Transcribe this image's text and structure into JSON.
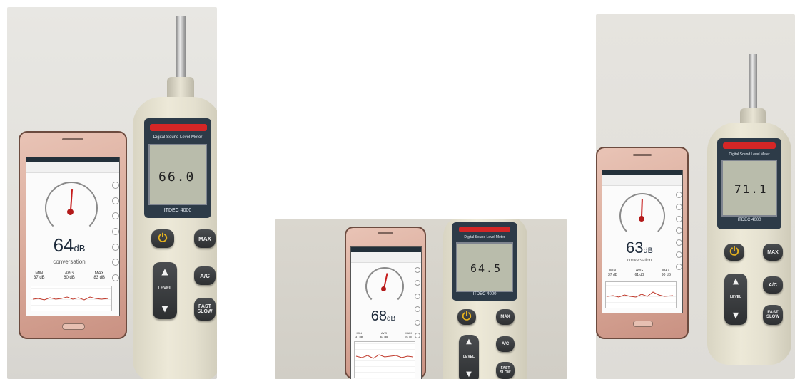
{
  "photos": [
    {
      "phone": {
        "reading": "64",
        "unit": "dB",
        "caption": "conversation",
        "stats_labels": [
          "MIN",
          "AVG",
          "MAX"
        ],
        "stats_values": [
          "37 dB",
          "60 dB",
          "83 dB"
        ]
      },
      "meter": {
        "brand": "Digital Sound Level Meter",
        "display": "66.0",
        "model": "ITDEC 4000"
      }
    },
    {
      "phone": {
        "reading": "68",
        "unit": "dB",
        "caption": "",
        "stats_labels": [
          "MIN",
          "AVG",
          "MAX"
        ],
        "stats_values": [
          "37 dB",
          "63 dB",
          "91 dB"
        ]
      },
      "meter": {
        "brand": "Digital Sound Level Meter",
        "display": "64.5",
        "model": "ITDEC 4000"
      }
    },
    {
      "phone": {
        "reading": "63",
        "unit": "dB",
        "caption": "conversation",
        "stats_labels": [
          "MIN",
          "AVG",
          "MAX"
        ],
        "stats_values": [
          "37 dB",
          "61 dB",
          "90 dB"
        ]
      },
      "meter": {
        "brand": "Digital Sound Level Meter",
        "display": "71.1",
        "model": "ITDEC 4000"
      }
    }
  ],
  "buttons": {
    "power": "⏻",
    "max": "MAX",
    "ac": "A/C",
    "level": "LEVEL",
    "fast_slow_1": "FAST",
    "fast_slow_2": "SLOW",
    "up": "▲",
    "down": "▼"
  },
  "icons": [
    "power-icon",
    "up-arrow-icon",
    "down-arrow-icon",
    "gauge-icon"
  ],
  "colors": {
    "phone_body": "#d9a999",
    "meter_body": "#ede9d8",
    "meter_bezel": "#2d3b48",
    "lcd": "#b9bcab",
    "needle": "#c61d1d"
  }
}
